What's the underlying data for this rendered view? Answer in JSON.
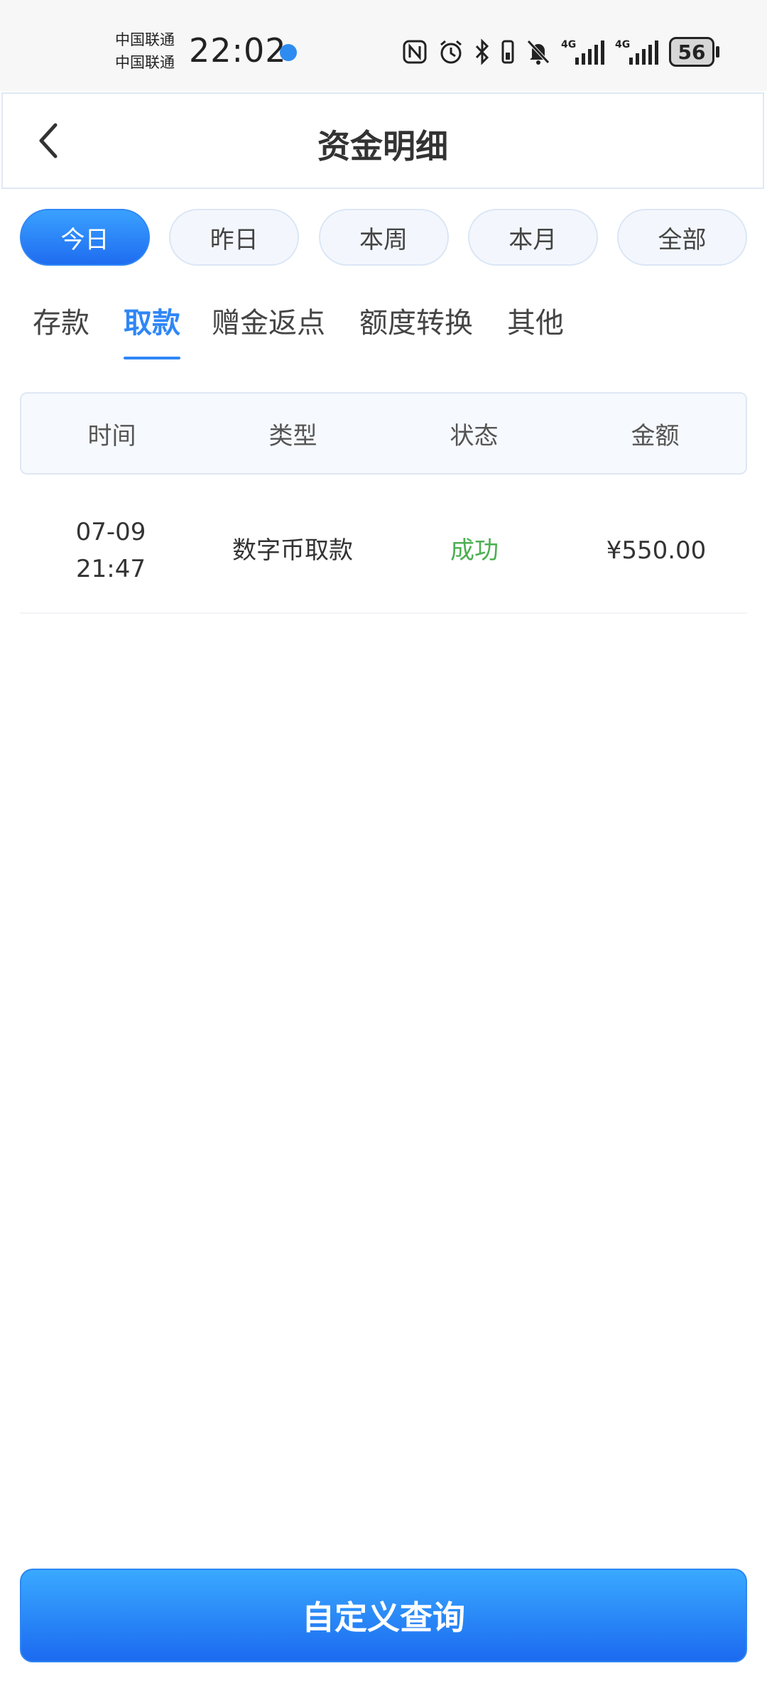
{
  "status_bar": {
    "carrier_1": "中国联通",
    "carrier_2": "中国联通",
    "time": "22:02",
    "network_1": "4G",
    "network_2": "4G",
    "battery": "56",
    "icons": [
      "nfc-icon",
      "alarm-icon",
      "bluetooth-icon",
      "vibrate-icon",
      "mute-icon",
      "signal-icon",
      "signal-icon"
    ]
  },
  "header": {
    "title": "资金明细",
    "back_icon": "chevron-left-icon"
  },
  "periods": [
    {
      "label": "今日",
      "active": true
    },
    {
      "label": "昨日",
      "active": false
    },
    {
      "label": "本周",
      "active": false
    },
    {
      "label": "本月",
      "active": false
    },
    {
      "label": "全部",
      "active": false
    }
  ],
  "tabs": [
    {
      "label": "存款",
      "active": false
    },
    {
      "label": "取款",
      "active": true
    },
    {
      "label": "赠金返点",
      "active": false
    },
    {
      "label": "额度转换",
      "active": false
    },
    {
      "label": "其他",
      "active": false
    }
  ],
  "table": {
    "headers": [
      "时间",
      "类型",
      "状态",
      "金额"
    ],
    "rows": [
      {
        "date": "07-09",
        "time": "21:47",
        "type": "数字币取款",
        "status": "成功",
        "amount": "¥550.00"
      }
    ]
  },
  "footer": {
    "query_button": "自定义查询"
  },
  "colors": {
    "accent": "#2f86f6",
    "success": "#4caf50"
  }
}
